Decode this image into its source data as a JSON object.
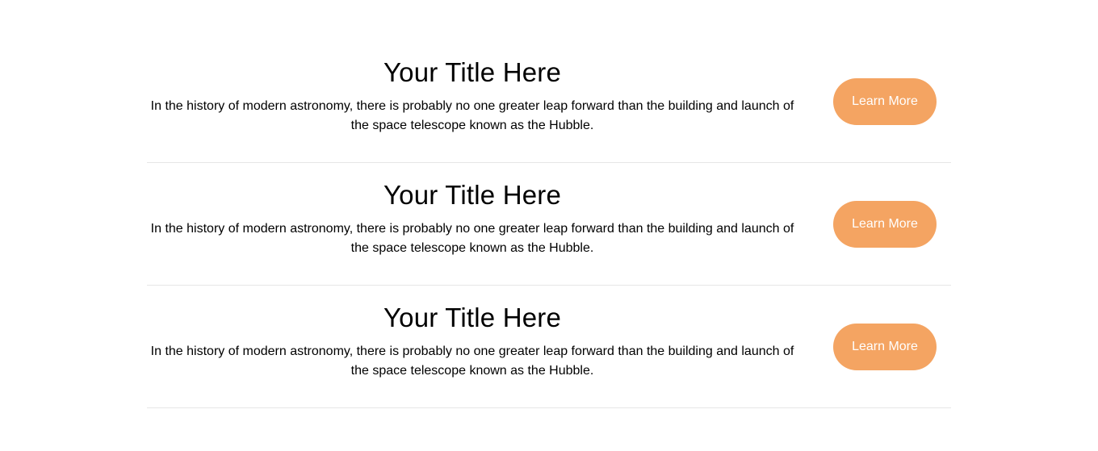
{
  "colors": {
    "button_bg": "#f4a462",
    "button_text": "#ffffff",
    "divider": "#e6e6e6"
  },
  "items": [
    {
      "title": "Your Title Here",
      "description": "In the history of modern astronomy, there is probably no one greater leap forward than the building and launch of the space telescope known as the Hubble.",
      "button_label": "Learn More"
    },
    {
      "title": "Your Title Here",
      "description": "In the history of modern astronomy, there is probably no one greater leap forward than the building and launch of the space telescope known as the Hubble.",
      "button_label": "Learn More"
    },
    {
      "title": "Your Title Here",
      "description": "In the history of modern astronomy, there is probably no one greater leap forward than the building and launch of the space telescope known as the Hubble.",
      "button_label": "Learn More"
    }
  ]
}
